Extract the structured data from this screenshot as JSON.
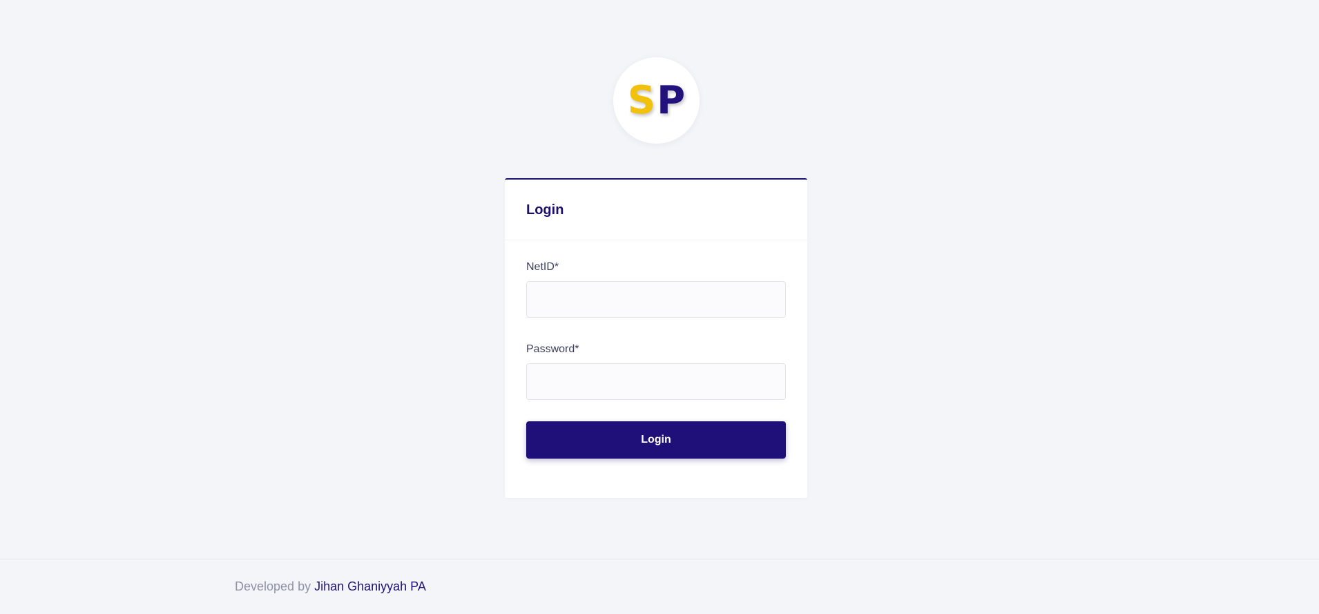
{
  "logo": {
    "letter_1": "S",
    "letter_2": "P",
    "color_1": "#f2c10c",
    "color_2": "#22127c"
  },
  "login_card": {
    "title": "Login",
    "netid_label": "NetID*",
    "netid_value": "",
    "password_label": "Password*",
    "password_value": "",
    "submit_label": "Login"
  },
  "footer": {
    "prefix": "Developed by",
    "author": "Jihan Ghaniyyah PA"
  },
  "colors": {
    "background": "#f4f5f9",
    "primary": "#1f0f78",
    "card": "#ffffff"
  }
}
